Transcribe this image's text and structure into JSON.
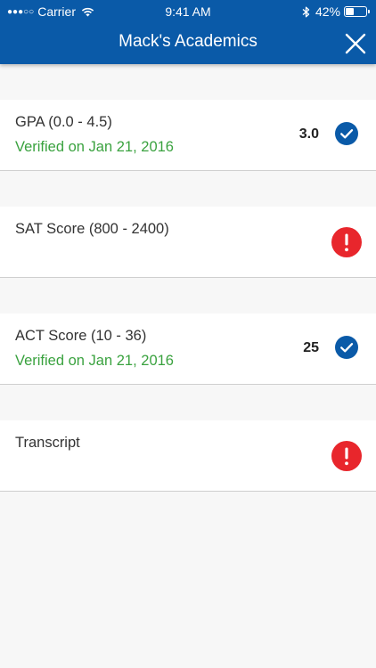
{
  "status_bar": {
    "signal": "●●●○○",
    "carrier": "Carrier",
    "time": "9:41 AM",
    "battery_pct": "42%",
    "battery_level": 0.42
  },
  "nav": {
    "title": "Mack's Academics",
    "close_icon": "close-icon"
  },
  "colors": {
    "nav_bg": "#0a5aa8",
    "verified_green": "#3aa23f",
    "check_blue": "#0a5aa8",
    "alert_red": "#e8262c"
  },
  "items": [
    {
      "label": "GPA (0.0 - 4.5)",
      "sub": "Verified on Jan 21, 2016",
      "value": "3.0",
      "status": "verified",
      "icon": "check-circle-icon"
    },
    {
      "label": "SAT Score (800 - 2400)",
      "sub": "",
      "value": "",
      "status": "missing",
      "icon": "alert-circle-icon"
    },
    {
      "label": "ACT Score (10 - 36)",
      "sub": "Verified on Jan 21, 2016",
      "value": "25",
      "status": "verified",
      "icon": "check-circle-icon"
    },
    {
      "label": "Transcript",
      "sub": "",
      "value": "",
      "status": "missing",
      "icon": "alert-circle-icon"
    }
  ]
}
